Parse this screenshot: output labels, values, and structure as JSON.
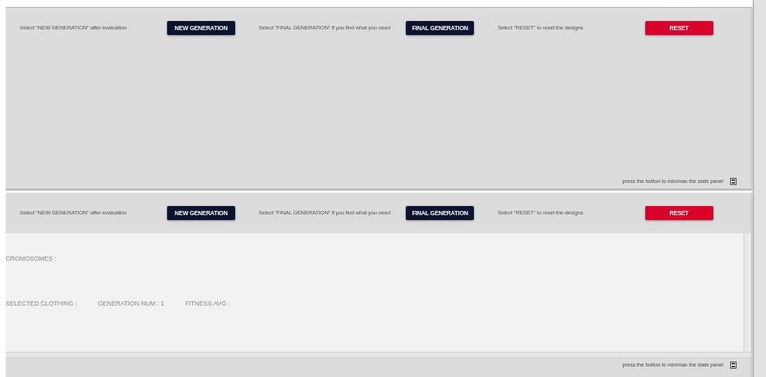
{
  "panels": [
    {
      "controls": [
        {
          "hint": "Select \"NEW GENERATION\" after evaluation",
          "button": "NEW GENERATION",
          "kind": "primary"
        },
        {
          "hint": "Select \"FINAL GENERATION\" if you find what you need",
          "button": "FINAL GENERATION",
          "kind": "primary"
        },
        {
          "hint": "Select \"RESET\" to reset the designs",
          "button": "RESET",
          "kind": "danger"
        }
      ],
      "footer": "press the button to min/max the stats panel"
    },
    {
      "controls": [
        {
          "hint": "Select \"NEW GENERATION\" after evaluation",
          "button": "NEW GENERATION",
          "kind": "primary"
        },
        {
          "hint": "Select \"FINAL GENERATION\" if you find what you need",
          "button": "FINAL GENERATION",
          "kind": "primary"
        },
        {
          "hint": "Select \"RESET\" to reset the designs",
          "button": "RESET",
          "kind": "danger"
        }
      ],
      "stats": {
        "chromosomes": "CROMOSOMES :",
        "fields": [
          "SELECTED CLOTHING :",
          "GENERATION NUM : 1",
          "FITNESS AVG :"
        ]
      },
      "footer": "press the button to min/max the stats panel"
    }
  ]
}
